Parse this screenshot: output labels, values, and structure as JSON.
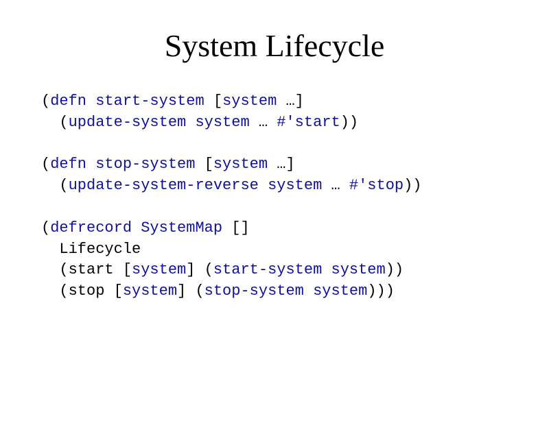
{
  "title": "System Lifecycle",
  "code": {
    "tokens": [
      [
        {
          "t": "(",
          "c": "tk-default"
        },
        {
          "t": "defn",
          "c": "tk-keyword"
        },
        {
          "t": " ",
          "c": "tk-default"
        },
        {
          "t": "start-system",
          "c": "tk-name"
        },
        {
          "t": " [",
          "c": "tk-default"
        },
        {
          "t": "system",
          "c": "tk-param"
        },
        {
          "t": " …]",
          "c": "tk-default"
        }
      ],
      [
        {
          "t": "  (",
          "c": "tk-default"
        },
        {
          "t": "update-system",
          "c": "tk-name"
        },
        {
          "t": " ",
          "c": "tk-default"
        },
        {
          "t": "system",
          "c": "tk-param"
        },
        {
          "t": " … ",
          "c": "tk-default"
        },
        {
          "t": "#'start",
          "c": "tk-name"
        },
        {
          "t": "))",
          "c": "tk-default"
        }
      ],
      [
        {
          "t": " ",
          "c": "tk-default"
        }
      ],
      [
        {
          "t": "(",
          "c": "tk-default"
        },
        {
          "t": "defn",
          "c": "tk-keyword"
        },
        {
          "t": " ",
          "c": "tk-default"
        },
        {
          "t": "stop-system",
          "c": "tk-name"
        },
        {
          "t": " [",
          "c": "tk-default"
        },
        {
          "t": "system",
          "c": "tk-param"
        },
        {
          "t": " …]",
          "c": "tk-default"
        }
      ],
      [
        {
          "t": "  (",
          "c": "tk-default"
        },
        {
          "t": "update-system-reverse",
          "c": "tk-name"
        },
        {
          "t": " ",
          "c": "tk-default"
        },
        {
          "t": "system",
          "c": "tk-param"
        },
        {
          "t": " … ",
          "c": "tk-default"
        },
        {
          "t": "#'stop",
          "c": "tk-name"
        },
        {
          "t": "))",
          "c": "tk-default"
        }
      ],
      [
        {
          "t": " ",
          "c": "tk-default"
        }
      ],
      [
        {
          "t": "(",
          "c": "tk-default"
        },
        {
          "t": "defrecord",
          "c": "tk-keyword"
        },
        {
          "t": " ",
          "c": "tk-default"
        },
        {
          "t": "SystemMap",
          "c": "tk-name"
        },
        {
          "t": " []",
          "c": "tk-default"
        }
      ],
      [
        {
          "t": "  Lifecycle",
          "c": "tk-default"
        }
      ],
      [
        {
          "t": "  (",
          "c": "tk-default"
        },
        {
          "t": "start",
          "c": "tk-default"
        },
        {
          "t": " [",
          "c": "tk-default"
        },
        {
          "t": "system",
          "c": "tk-param"
        },
        {
          "t": "] (",
          "c": "tk-default"
        },
        {
          "t": "start-system",
          "c": "tk-name"
        },
        {
          "t": " ",
          "c": "tk-default"
        },
        {
          "t": "system",
          "c": "tk-param"
        },
        {
          "t": "))",
          "c": "tk-default"
        }
      ],
      [
        {
          "t": "  (",
          "c": "tk-default"
        },
        {
          "t": "stop",
          "c": "tk-default"
        },
        {
          "t": " [",
          "c": "tk-default"
        },
        {
          "t": "system",
          "c": "tk-param"
        },
        {
          "t": "] (",
          "c": "tk-default"
        },
        {
          "t": "stop-system",
          "c": "tk-name"
        },
        {
          "t": " ",
          "c": "tk-default"
        },
        {
          "t": "system",
          "c": "tk-param"
        },
        {
          "t": ")))",
          "c": "tk-default"
        }
      ]
    ]
  }
}
